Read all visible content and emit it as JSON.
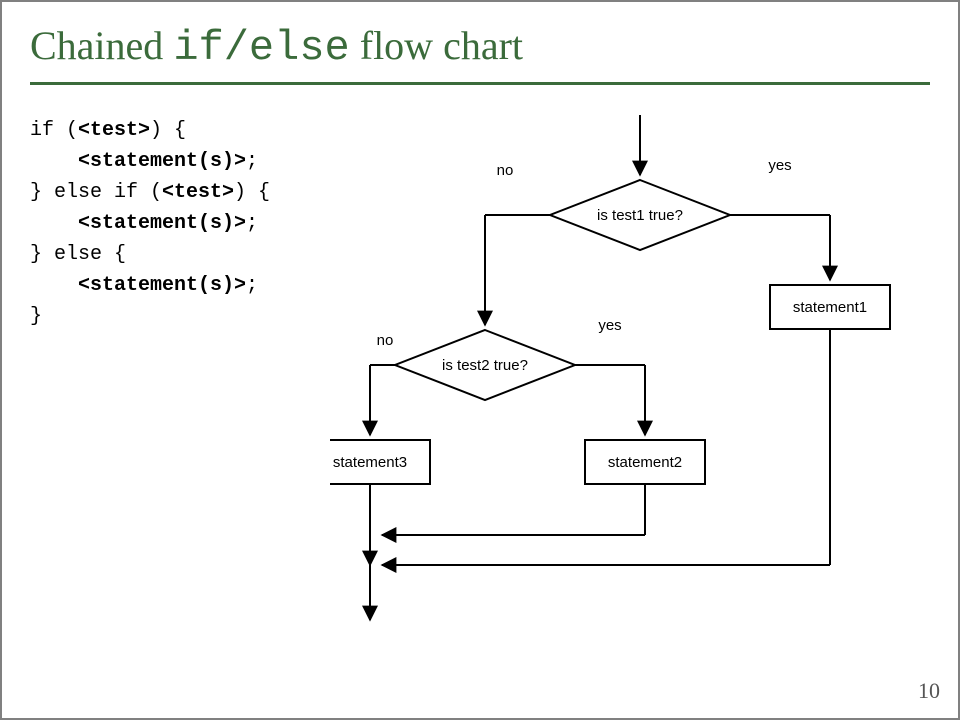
{
  "title": {
    "prefix": "Chained ",
    "mono": "if/else",
    "suffix": " flow chart"
  },
  "code": {
    "l1a": "if (",
    "l1b": "<test>",
    "l1c": ") {",
    "l2a": "    ",
    "l2b": "<statement(s)>",
    "l2c": ";",
    "l3a": "} else if (",
    "l3b": "<test>",
    "l3c": ") {",
    "l4a": "    ",
    "l4b": "<statement(s)>",
    "l4c": ";",
    "l5": "} else {",
    "l6a": "    ",
    "l6b": "<statement(s)>",
    "l6c": ";",
    "l7": "}"
  },
  "diagram": {
    "test1": "is test1 true?",
    "test2": "is test2 true?",
    "stmt1": "statement1",
    "stmt2": "statement2",
    "stmt3": "statement3",
    "yes": "yes",
    "no": "no"
  },
  "pagenum": "10"
}
